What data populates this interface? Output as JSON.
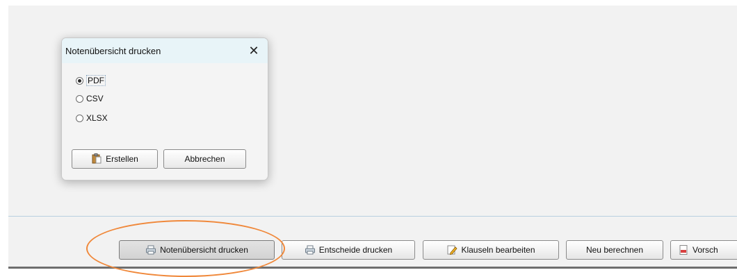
{
  "dialog": {
    "title": "Notenübersicht drucken",
    "options": [
      {
        "label": "PDF",
        "selected": true
      },
      {
        "label": "CSV",
        "selected": false
      },
      {
        "label": "XLSX",
        "selected": false
      }
    ],
    "create_label": "Erstellen",
    "cancel_label": "Abbrechen",
    "close_icon": "close-icon"
  },
  "toolbar": {
    "buttons": [
      {
        "label": "Notenübersicht drucken",
        "icon": "printer-icon",
        "pressed": true
      },
      {
        "label": "Entscheide drucken",
        "icon": "printer-icon",
        "pressed": false
      },
      {
        "label": "Klauseln bearbeiten",
        "icon": "edit-document-icon",
        "pressed": false
      },
      {
        "label": "Neu berechnen",
        "icon": "",
        "pressed": false
      },
      {
        "label": "Vorsch",
        "icon": "pdf-document-icon",
        "pressed": false
      }
    ]
  },
  "colors": {
    "highlight": "#f0883a",
    "dialog_titlebar": "#e8f4f8",
    "panel_background": "#f2f2f2"
  }
}
